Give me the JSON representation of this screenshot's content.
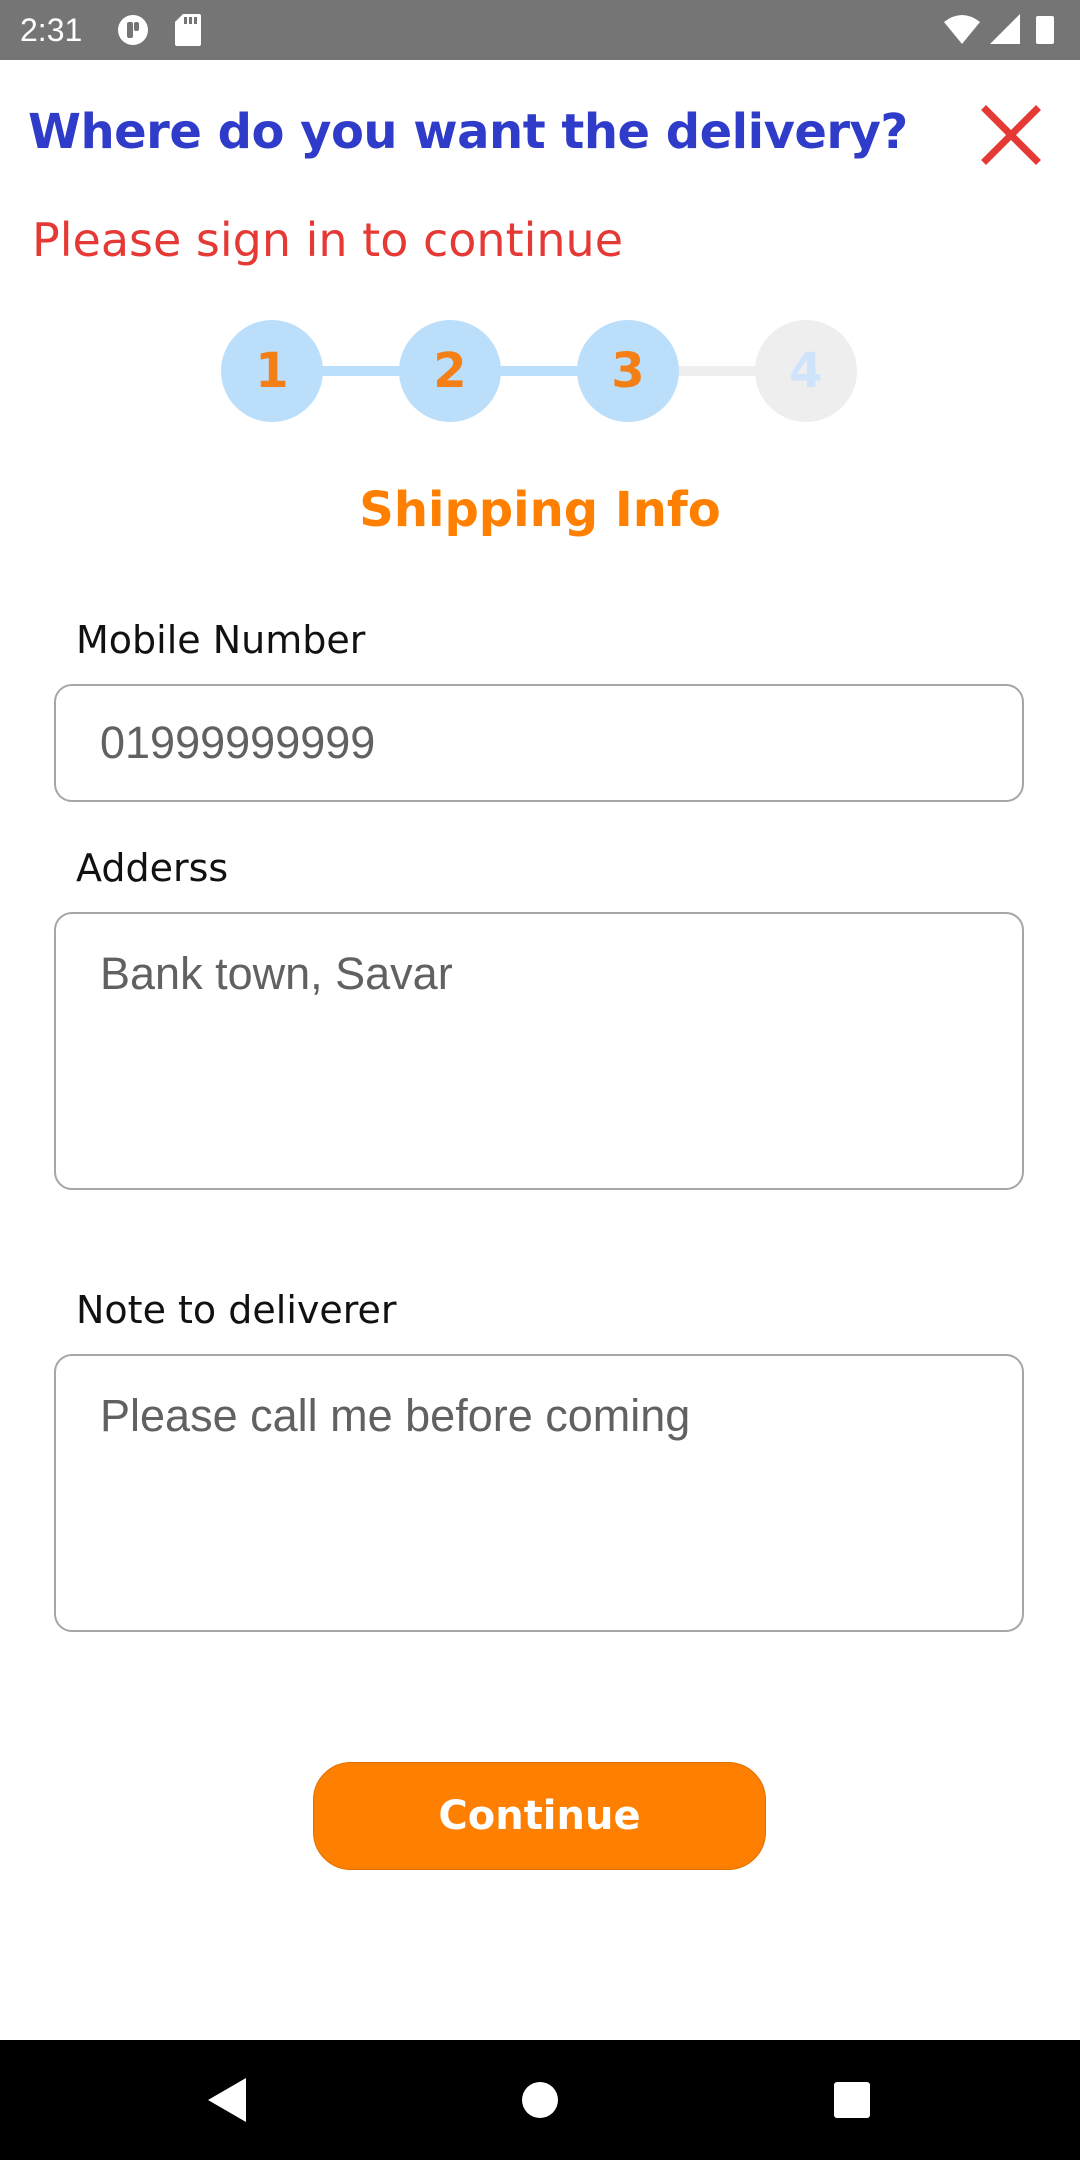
{
  "status_bar": {
    "time": "2:31",
    "icons": [
      "notification-icon",
      "sd-card-icon",
      "wifi-icon",
      "signal-icon",
      "battery-icon"
    ]
  },
  "header": {
    "title": "Where do you want the delivery?",
    "close_icon": "close-icon",
    "signin_message": "Please sign in to continue"
  },
  "stepper": {
    "steps": [
      {
        "label": "1",
        "active": true
      },
      {
        "label": "2",
        "active": true
      },
      {
        "label": "3",
        "active": true
      },
      {
        "label": "4",
        "active": false
      }
    ]
  },
  "section_title": "Shipping Info",
  "form": {
    "mobile": {
      "label": "Mobile Number",
      "placeholder": "01999999999"
    },
    "address": {
      "label": "Adderss",
      "placeholder": "Bank town, Savar"
    },
    "note": {
      "label": "Note to deliverer",
      "placeholder": "Please call me before coming"
    }
  },
  "actions": {
    "continue_label": "Continue"
  },
  "nav_bar": {
    "icons": [
      "back-icon",
      "home-icon",
      "recents-icon"
    ]
  },
  "colors": {
    "title": "#2f3bc9",
    "error": "#e53935",
    "accent": "#ff8000",
    "step_active": "#bbdefb",
    "step_inactive": "#eeeeee",
    "status_bar": "#757575"
  }
}
